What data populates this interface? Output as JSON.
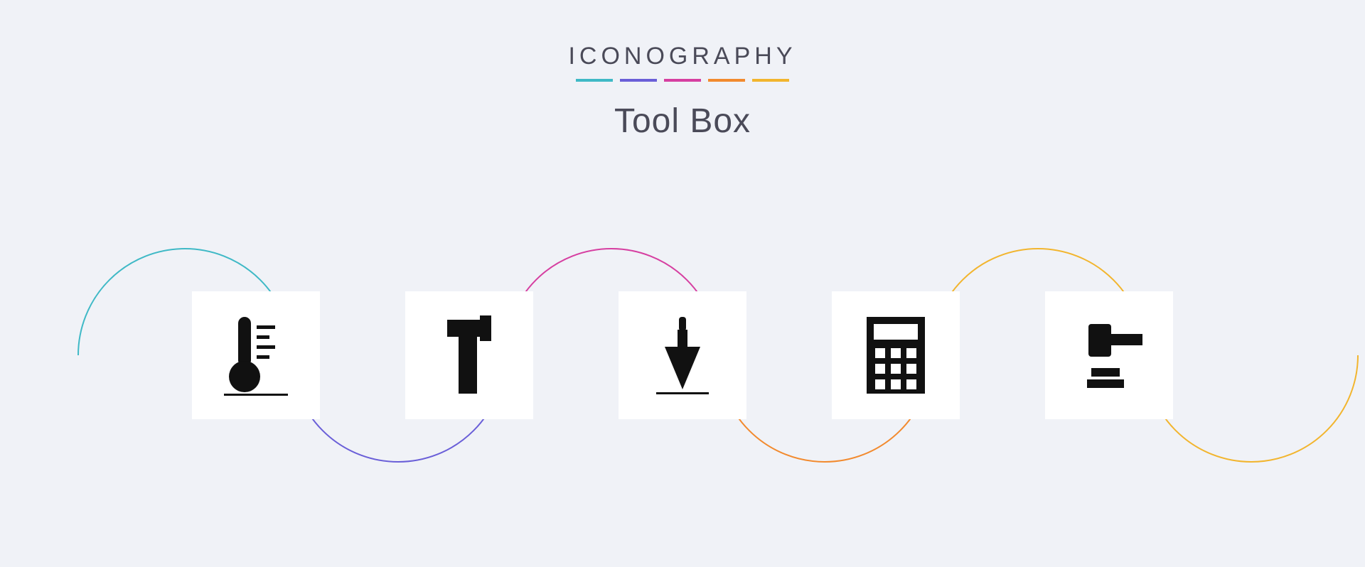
{
  "brand": "ICONOGRAPHY",
  "title": "Tool Box",
  "colors": {
    "accent1": "#3fb9c6",
    "accent2": "#6a5fd8",
    "accent3": "#d63fa1",
    "accent4": "#f28a2e",
    "accent5": "#f2b52e"
  },
  "icons": [
    {
      "name": "thermometer-icon"
    },
    {
      "name": "hammer-icon"
    },
    {
      "name": "trowel-icon"
    },
    {
      "name": "calculator-icon"
    },
    {
      "name": "gavel-icon"
    }
  ]
}
